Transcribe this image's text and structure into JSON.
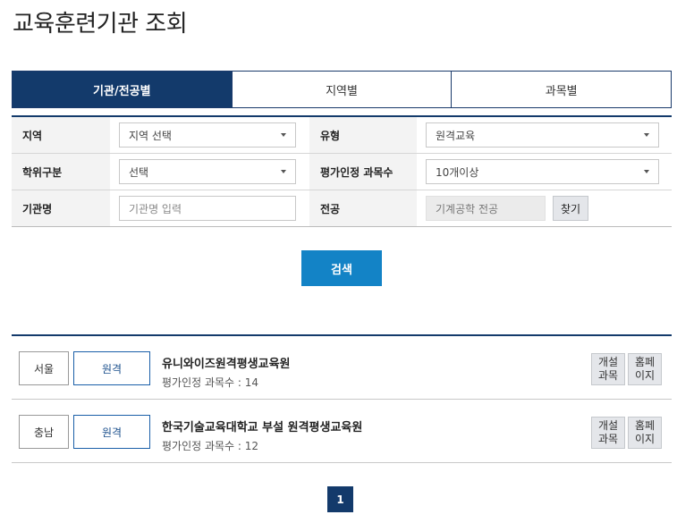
{
  "page": {
    "title": "교육훈련기관 조회"
  },
  "tabs": [
    {
      "label": "기관/전공별",
      "active": true
    },
    {
      "label": "지역별",
      "active": false
    },
    {
      "label": "과목별",
      "active": false
    }
  ],
  "form": {
    "region_label": "지역",
    "region_value": "지역 선택",
    "type_label": "유형",
    "type_value": "원격교육",
    "degree_label": "학위구분",
    "degree_value": "선택",
    "eval_label": "평가인정 과목수",
    "eval_value": "10개이상",
    "inst_label": "기관명",
    "inst_placeholder": "기관명 입력",
    "major_label": "전공",
    "major_value": "기계공학 전공",
    "find_label": "찾기"
  },
  "search": {
    "label": "검색"
  },
  "results": [
    {
      "region": "서울",
      "type": "원격",
      "name": "유니와이즈원격평생교육원",
      "count": "평가인정 과목수 : 14",
      "open_label": "개설과목",
      "home_label": "홈페이지"
    },
    {
      "region": "충남",
      "type": "원격",
      "name": "한국기술교육대학교 부설 원격평생교육원",
      "count": "평가인정 과목수 : 12",
      "open_label": "개설과목",
      "home_label": "홈페이지"
    }
  ],
  "pagination": {
    "current": "1"
  },
  "colors": {
    "primary": "#133a6b",
    "accent": "#1383c6"
  }
}
